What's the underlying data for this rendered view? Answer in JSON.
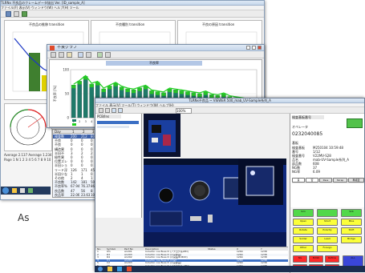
{
  "back_window": {
    "title": "TLRNx 不良品のクレームデータ抜出 Ver.  [ID_sample_A]",
    "menu": "ファイル(F)  表示(V)  ウィンドウ(W)  ヘルプ(H)  ツール",
    "panel_titles": [
      "不良品の推移 transition",
      "不良種別 transition",
      "不良の原因 transition"
    ],
    "status": "Average 2.137  Average 1.234",
    "status2": "Page 1  N 1 2 3 4 5 6 7 8 9 10",
    "table": {
      "header": [
        "Day",
        "1",
        "2",
        "3"
      ],
      "rows": [
        [
          "検査数",
          "200",
          "212",
          "80"
        ],
        [
          "不良",
          "0",
          "0",
          "0"
        ],
        [
          "不良",
          "0",
          "0",
          "0"
        ],
        [
          "構造異",
          "0",
          "0",
          "0"
        ],
        [
          "半田不",
          "3",
          "2",
          "2"
        ],
        [
          "極性異",
          "0",
          "0",
          "0"
        ],
        [
          "位置ズレ",
          "0",
          "0",
          "0"
        ],
        [
          "半田ショ",
          "0",
          "0",
          "0"
        ],
        [
          "リード浮",
          "126",
          "171",
          "45"
        ],
        [
          "半田少な",
          "1",
          "1",
          "0"
        ],
        [
          "その他",
          "2",
          "4",
          "1"
        ],
        [
          "不良数",
          "142",
          "181",
          "50"
        ],
        [
          "不良率%",
          "67.94",
          "76.37",
          "86.2"
        ],
        [
          "良品数",
          "47",
          "56",
          "8"
        ],
        [
          "良品率",
          "22.06",
          "23.63",
          "10.7"
        ]
      ]
    }
  },
  "chart_window": {
    "title": "不良グラフ",
    "chart_title": "不良率",
    "ylabel": "不良率 [%]",
    "legend": [
      "不良率",
      "不良率 [%]"
    ]
  },
  "chart_data": {
    "type": "bar",
    "title": "不良率",
    "ylabel": "不良率 [%]",
    "ylim": [
      0,
      100
    ],
    "categories": [
      "1",
      "2",
      "3",
      "4",
      "5",
      "6",
      "7",
      "8",
      "9",
      "10",
      "11",
      "12",
      "13",
      "14",
      "15",
      "16",
      "17",
      "18",
      "19",
      "20",
      "21",
      "22",
      "23",
      "24",
      "25",
      "26",
      "27",
      "28",
      "29",
      "30",
      "31"
    ],
    "series": [
      {
        "name": "不良率",
        "values": [
          68,
          76,
          86,
          70,
          74,
          60,
          66,
          72,
          64,
          60,
          58,
          62,
          66,
          56,
          54,
          52,
          60,
          58,
          56,
          54,
          52,
          50,
          54,
          48,
          46,
          50,
          44,
          42,
          40,
          38,
          36
        ]
      }
    ]
  },
  "front_window": {
    "title": "TLRNx不良品 ~ VIEWER 500_mab_UV-Sample系列_A",
    "menu": "ファイル  表示(V)  ツール(T)  ウィンドウ(W)  ヘルプ(H)",
    "left_tab": "PCB/Ins",
    "toolbar_zoom": "100%",
    "footer_tab": "Ins",
    "info": {
      "section1": "検査基板番号",
      "label_operator": "オペレータ",
      "operator_value": "0232040085",
      "section2": "基板",
      "items": [
        [
          "検査基板",
          "M250104 10:59:48"
        ],
        [
          "番号",
          "1/12"
        ],
        [
          "検査番号",
          "V22MV-S28"
        ],
        [
          "品名",
          "mab-UV-Sample系列_A"
        ],
        [
          "部品数",
          "608"
        ],
        [
          "NG数",
          "37"
        ],
        [
          "NG率",
          "6.09"
        ]
      ],
      "tabs": [
        "良",
        "否",
        "Pass",
        "Skrap",
        "再検査"
      ]
    },
    "keypad": {
      "green": [
        "Sim",
        "",
        "Slib"
      ],
      "yellow": [
        "Open",
        "Short",
        "Miss",
        "Rotate",
        "Polarity",
        "Shift",
        "Solder",
        "Lead",
        "Bridge",
        "Other",
        "Foreign"
      ],
      "red": [
        "NG",
        "MASK",
        "Reflow",
        "",
        "",
        ""
      ],
      "blue": [
        "ALL"
      ]
    },
    "list": {
      "headers": [
        "No.",
        "Symbol",
        "Part No",
        "Description",
        "Status",
        "X",
        "Y"
      ],
      "rows": [
        [
          "1",
          "IC1",
          "A1201",
          "Inductor cos Buss D (アナログ系LED)",
          "",
          "1264",
          "1238"
        ],
        [
          "2",
          "R3",
          "A1203",
          "Inductor cos Buss D (不良部品)",
          "",
          "1264",
          "1238"
        ],
        [
          "3",
          "R4",
          "A1202",
          "Inductor cos Buss D (不良品ID-BCD)",
          "",
          "1264",
          "1238"
        ],
        [
          "4",
          "C1",
          "A1203",
          "Inductor cos Buss D (不良)",
          "",
          "1264",
          "1238"
        ],
        [
          "5",
          "C2",
          "A1203",
          "Inductor cos Buss D (不良部品)",
          "",
          "1264",
          "1238"
        ],
        [
          "6",
          "C5",
          "A1203",
          "Inductor cos Buss D (アナログ系 LED)",
          "",
          "1264",
          "1238"
        ]
      ]
    }
  },
  "watermark": "As"
}
